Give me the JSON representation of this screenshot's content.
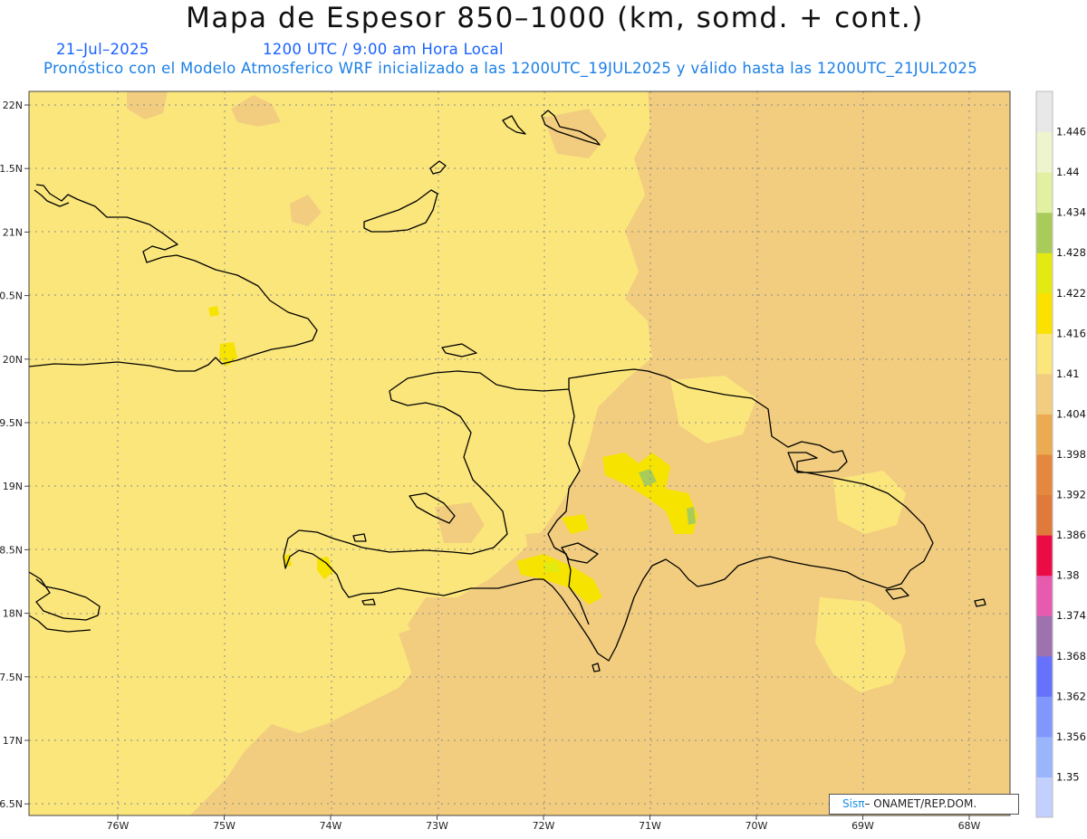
{
  "title": "Mapa de Espesor 850–1000 (km, somd. + cont.)",
  "date_label": "21–Jul–2025",
  "time_label": "1200 UTC / 9:00 am Hora Local",
  "model_label": "Pronóstico con el Modelo Atmosferico WRF inicializado a las 1200UTC_19JUL2025 y válido hasta las  1200UTC_21JUL2025",
  "credit": {
    "logo": "Sisπ",
    "text": "– ONAMET/REP.DOM."
  },
  "axes": {
    "lon_labels": [
      "76W",
      "75W",
      "74W",
      "73W",
      "72W",
      "71W",
      "70W",
      "69W",
      "68W"
    ],
    "lat_labels": [
      "22N",
      "1.5N",
      "21N",
      "0.5N",
      "20N",
      "9.5N",
      "19N",
      "8.5N",
      "18N",
      "7.5N",
      "17N",
      "6.5N"
    ]
  },
  "colorbar": {
    "levels": [
      "1.35",
      "1.356",
      "1.362",
      "1.368",
      "1.374",
      "1.38",
      "1.386",
      "1.392",
      "1.398",
      "1.404",
      "1.41",
      "1.416",
      "1.422",
      "1.428",
      "1.434",
      "1.44",
      "1.446"
    ],
    "colors": [
      "#c3cffd",
      "#99b5fc",
      "#7f97ff",
      "#6672fb",
      "#9d72ae",
      "#e65bae",
      "#eb0c46",
      "#e07a3a",
      "#e5873d",
      "#ebab50",
      "#f2cd7f",
      "#fbe67c",
      "#fae100",
      "#e2ea12",
      "#a9cb5a",
      "#e2f0a2",
      "#eef5cc",
      "#e8e8e8"
    ]
  },
  "colors": {
    "field_high": "#f2cd7f",
    "field_mid": "#fbe67c",
    "field_max": "#f7e300",
    "coast": "#000000",
    "grid": "#888888"
  }
}
